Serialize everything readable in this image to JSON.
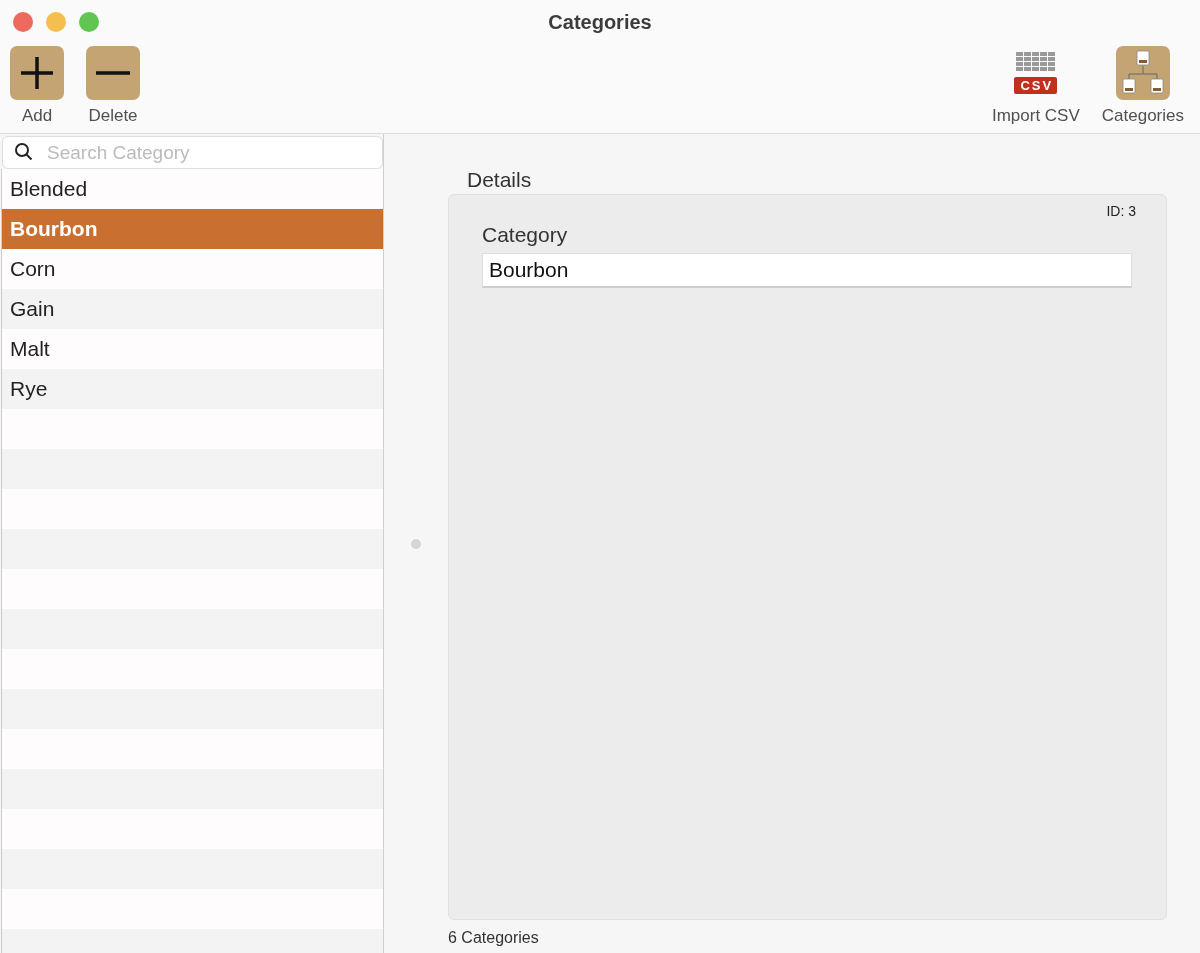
{
  "window": {
    "title": "Categories"
  },
  "toolbar": {
    "left": [
      {
        "kind": "add",
        "label": "Add"
      },
      {
        "kind": "delete",
        "label": "Delete"
      }
    ],
    "right": [
      {
        "kind": "csv",
        "label": "Import CSV",
        "badge": "CSV"
      },
      {
        "kind": "categories",
        "label": "Categories"
      }
    ]
  },
  "search": {
    "placeholder": "Search Category"
  },
  "categories": [
    {
      "name": "Blended",
      "selected": false
    },
    {
      "name": "Bourbon",
      "selected": true
    },
    {
      "name": "Corn",
      "selected": false
    },
    {
      "name": "Gain",
      "selected": false
    },
    {
      "name": "Malt",
      "selected": false
    },
    {
      "name": "Rye",
      "selected": false
    }
  ],
  "details": {
    "heading": "Details",
    "id_label": "ID: 3",
    "field_label": "Category",
    "field_value": "Bourbon"
  },
  "status_bar": "6 Categories"
}
